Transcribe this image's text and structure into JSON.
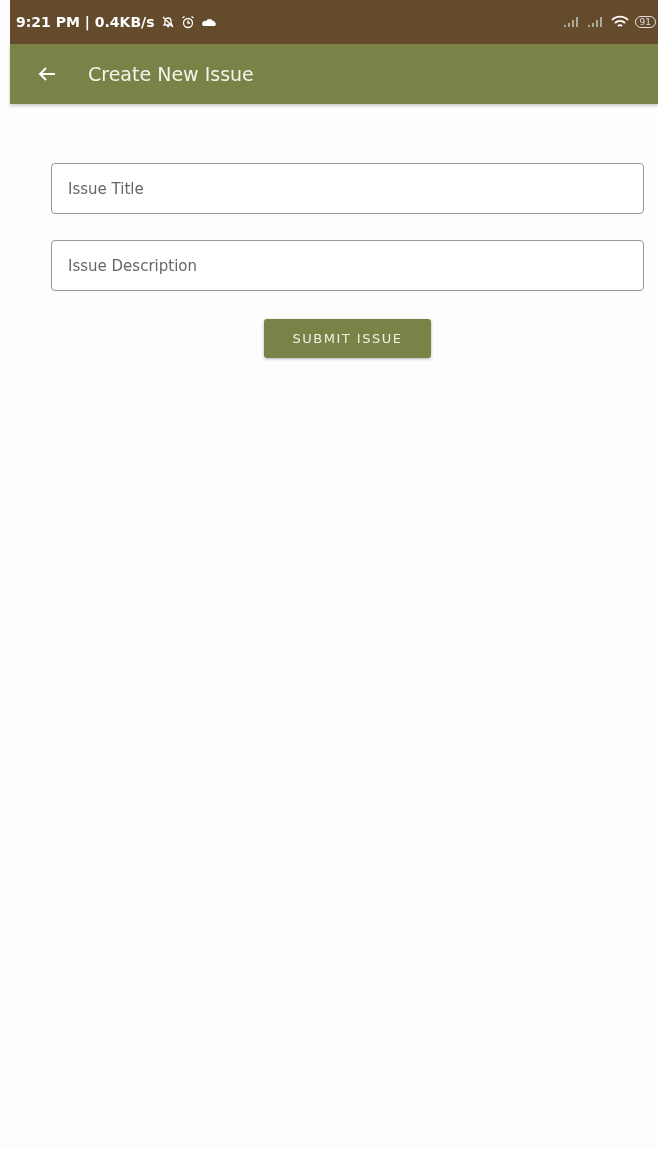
{
  "status_bar": {
    "time": "9:21 PM | 0.4KB/s",
    "battery": "91"
  },
  "app_bar": {
    "title": "Create New Issue"
  },
  "form": {
    "fields": [
      {
        "placeholder": "Issue Title"
      },
      {
        "placeholder": "Issue Description"
      }
    ],
    "submit": "SUBMIT ISSUE"
  }
}
